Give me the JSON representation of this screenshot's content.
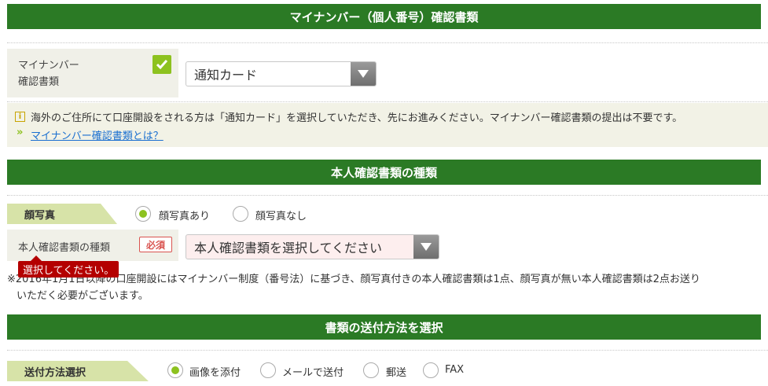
{
  "section1": {
    "title": "マイナンバー（個人番号）確認書類"
  },
  "mynumber": {
    "label_line1": "マイナンバー",
    "label_line2": "確認書類",
    "select_value": "通知カード"
  },
  "info": {
    "text": "海外のご住所にて口座開設をされる方は「通知カード」を選択していただき、先にお進みください。マイナンバー確認書類の提出は不要です。",
    "link_prefix": "»",
    "link_text": "マイナンバー確認書類とは？"
  },
  "section2": {
    "title": "本人確認書類の種類"
  },
  "photo": {
    "label": "顔写真",
    "options": [
      "顔写真あり",
      "顔写真なし"
    ],
    "selected": 0
  },
  "idtype": {
    "label": "本人確認書類の種類",
    "required": "必須",
    "select_value": "本人確認書類を選択してください",
    "tooltip": "選択してください。"
  },
  "note": {
    "line1": "※2016年1月1日以降の口座開設にはマイナンバー制度（番号法）に基づき、顔写真付きの本人確認書類は1点、顔写真が無い本人確認書類は2点お送り",
    "line2": "いただく必要がございます。"
  },
  "section3": {
    "title": "書類の送付方法を選択"
  },
  "send": {
    "label": "送付方法選択",
    "options": [
      "画像を添付",
      "メールで送付",
      "郵送",
      "FAX"
    ],
    "selected": 0
  },
  "colors": {
    "header_green": "#2b7a25",
    "accent_green": "#8dc21f",
    "error_red": "#b40000"
  }
}
